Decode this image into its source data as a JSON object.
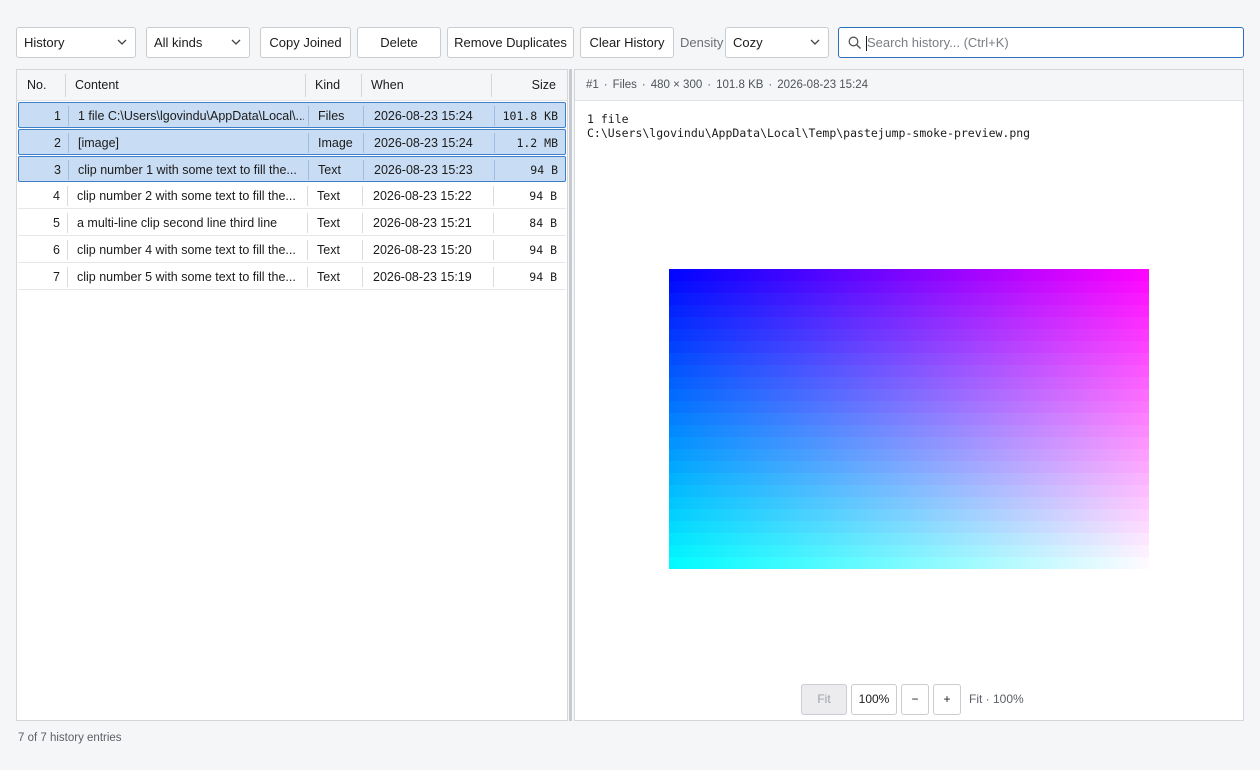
{
  "toolbar": {
    "view_select": "History",
    "kind_select": "All kinds",
    "copy_joined": "Copy Joined",
    "delete": "Delete",
    "remove_duplicates": "Remove Duplicates",
    "clear_history": "Clear History",
    "density_label": "Density",
    "density_select": "Cozy",
    "search_placeholder": "Search history...  (Ctrl+K)"
  },
  "table": {
    "headers": {
      "no": "No.",
      "content": "Content",
      "kind": "Kind",
      "when": "When",
      "size": "Size"
    },
    "rows": [
      {
        "no": "1",
        "content": "1 file C:\\Users\\lgovindu\\AppData\\Local\\...",
        "kind": "Files",
        "when": "2026-08-23 15:24",
        "size": "101.8 KB",
        "selected": true
      },
      {
        "no": "2",
        "content": "[image]",
        "kind": "Image",
        "when": "2026-08-23 15:24",
        "size": "1.2 MB",
        "selected": true
      },
      {
        "no": "3",
        "content": "clip number 1 with some text to fill the...",
        "kind": "Text",
        "when": "2026-08-23 15:23",
        "size": "94 B",
        "selected": true
      },
      {
        "no": "4",
        "content": "clip number 2 with some text to fill the...",
        "kind": "Text",
        "when": "2026-08-23 15:22",
        "size": "94 B",
        "selected": false
      },
      {
        "no": "5",
        "content": "a multi-line clip second line third line",
        "kind": "Text",
        "when": "2026-08-23 15:21",
        "size": "84 B",
        "selected": false
      },
      {
        "no": "6",
        "content": "clip number 4 with some text to fill the...",
        "kind": "Text",
        "when": "2026-08-23 15:20",
        "size": "94 B",
        "selected": false
      },
      {
        "no": "7",
        "content": "clip number 5 with some text to fill the...",
        "kind": "Text",
        "when": "2026-08-23 15:19",
        "size": "94 B",
        "selected": false
      }
    ]
  },
  "preview": {
    "meta": {
      "index": "#1",
      "kind": "Files",
      "dimensions": "480 × 300",
      "size": "101.8 KB",
      "when": "2026-08-23 15:24"
    },
    "text_line1": "1 file",
    "text_line2": "C:\\Users\\lgovindu\\AppData\\Local\\Temp\\pastejump-smoke-preview.png",
    "image_colors": {
      "top_left": "#0000ff",
      "top_right": "#ff00ff",
      "bottom_left": "#00ffff",
      "bottom_right": "#ffffff"
    },
    "zoom": {
      "fit": "Fit",
      "hundred": "100%",
      "minus": "−",
      "plus": "+",
      "info": "Fit · 100%"
    }
  },
  "status": "7 of 7 history entries"
}
